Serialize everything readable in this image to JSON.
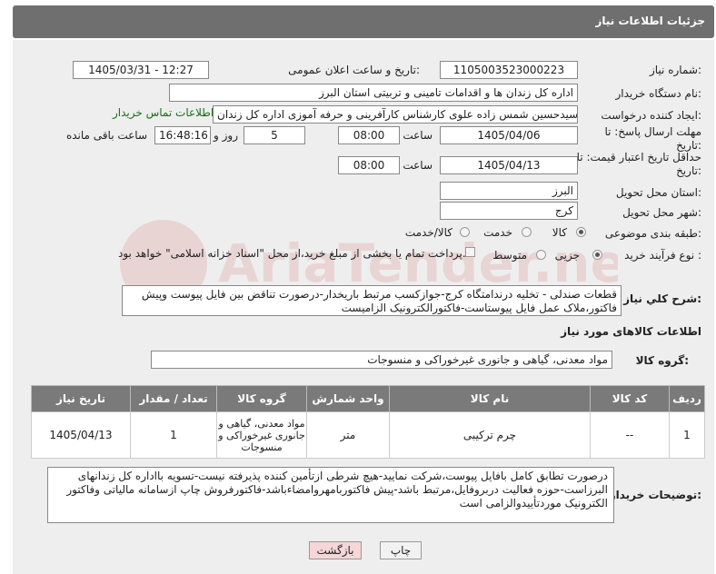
{
  "header": {
    "title": "جزئیات اطلاعات نیاز"
  },
  "form": {
    "need_number_label": "شماره نیاز:",
    "need_number": "1105003523000223",
    "announce_label": "تاریخ و ساعت اعلان عمومی:",
    "announce_value": "1405/03/31 - 12:27",
    "buyer_org_label": "نام دستگاه خریدار:",
    "buyer_org": "اداره کل زندان ها و اقدامات تامینی و تربیتی استان البرز",
    "creator_label": "ایجاد کننده درخواست:",
    "creator": "سیدحسین شمس زاده علوی کارشناس کارآفرینی و حرفه آموزی اداره کل زندان",
    "contact_link": "اطلاعات تماس خریدار",
    "send_deadline_label": "مهلت ارسال پاسخ: تا تاریخ:",
    "send_date": "1405/04/06",
    "time_label": "ساعت",
    "send_time": "08:00",
    "days_label": "روز و",
    "days": "5",
    "remaining_time": "16:48:16",
    "remaining_label": "ساعت باقی مانده",
    "validity_label": "حداقل تاریخ اعتبار قیمت: تا تاریخ:",
    "validity_date": "1405/04/13",
    "validity_time": "08:00",
    "province_label": "استان محل تحویل:",
    "province": "البرز",
    "city_label": "شهر محل تحویل:",
    "city": "کرج",
    "category_label": "طبقه بندی موضوعی:",
    "category_options": [
      "کالا",
      "خدمت",
      "کالا/خدمت"
    ],
    "process_label": "نوع فرآیند خرید :",
    "process_options": [
      "جزیی",
      "متوسط"
    ],
    "payment_note": "پرداخت تمام یا بخشی از مبلغ خرید،از محل \"اسناد خزانه اسلامی\" خواهد بود.",
    "summary_label": "شرح کلي نياز:",
    "summary": "قطعات صندلی - تخلیه درندامتگاه کرج-جوازکسب مرتبط باریخدار-درصورت تناقض بین فایل پیوست وپیش فاکتور،ملاک عمل فایل پیوستاست-فاکتورالکترونیک الزامیست"
  },
  "goods": {
    "section_title": "اطلاعات کالاهای مورد نیاز",
    "group_label": "گروه کالا:",
    "group_value": "مواد معدنی، گیاهی و جانوری غیرخوراکی و منسوجات",
    "columns": [
      "ردیف",
      "کد کالا",
      "نام کالا",
      "واحد شمارش",
      "گروه کالا",
      "تعداد / مقدار",
      "تاریخ نیاز"
    ],
    "rows": [
      {
        "row": "1",
        "code": "--",
        "name": "چرم ترکیبی",
        "unit": "متر",
        "group": "مواد معدنی، گیاهی و جانوری غیرخوراکی و منسوجات",
        "qty": "1",
        "date": "1405/04/13"
      }
    ]
  },
  "buyer_notes": {
    "label": "توضیحات خریدار:",
    "text": "درصورت تطابق کامل بافایل پیوست،شرکت نمایید-هیچ شرطی ازتأمین کننده پذیرفته نیست-تسویه بااداره کل زندانهای البرزاست-حوزه فعالیت دربروفایل،مرتبط باشد-پیش فاکتوربامهروامضاءباشد-فاکتورفروش چاپ ازسامانه مالیاتی وفاکتور الکترونیک موردتأییدوالزامی است"
  },
  "buttons": {
    "print": "چاپ",
    "back": "بازگشت"
  },
  "watermark": {
    "text": "AriaTender.net"
  }
}
